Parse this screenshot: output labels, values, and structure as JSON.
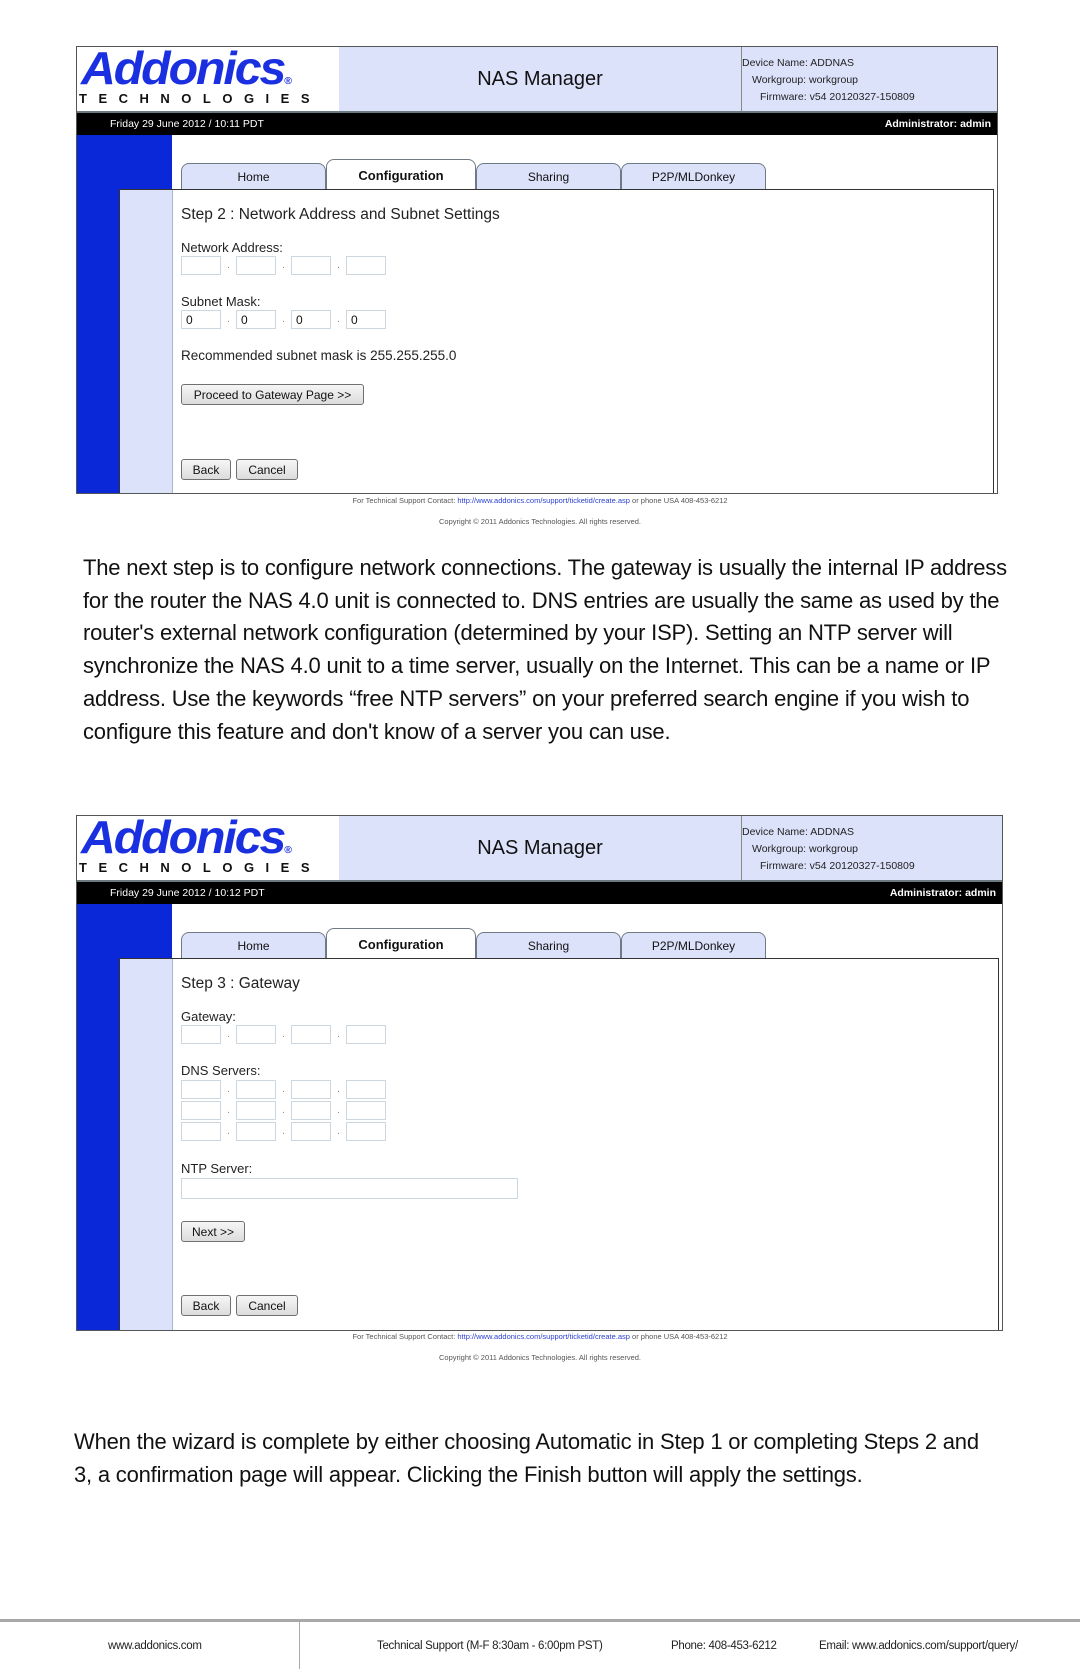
{
  "screenshots": [
    {
      "header": {
        "logo_word": "Addonics",
        "logo_reg": "®",
        "logo_sub": "TECHNOLOGIES",
        "title": "NAS Manager",
        "device_name": "Device Name: ADDNAS",
        "workgroup": "Workgroup: workgroup",
        "firmware": "Firmware: v54 20120327-150809"
      },
      "bar": {
        "date": "Friday 29 June 2012 / 10:11 PDT",
        "admin": "Administrator: admin"
      },
      "tabs": [
        {
          "label": "Home",
          "active": false
        },
        {
          "label": "Configuration",
          "active": true
        },
        {
          "label": "Sharing",
          "active": false
        },
        {
          "label": "P2P/MLDonkey",
          "active": false
        }
      ],
      "step_title": "Step 2 : Network Address and Subnet Settings",
      "network_address": {
        "label": "Network Address:",
        "octets": [
          "",
          "",
          "",
          ""
        ]
      },
      "subnet_mask": {
        "label": "Subnet Mask:",
        "octets": [
          "0",
          "0",
          "0",
          "0"
        ]
      },
      "recommendation": "Recommended subnet mask is 255.255.255.0",
      "proceed_button": "Proceed to Gateway Page >>",
      "back_button": "Back",
      "cancel_button": "Cancel",
      "footer": {
        "support_prefix": "For Technical Support Contact: ",
        "support_link": "http://www.addonics.com/support/ticketid/create.asp",
        "support_suffix": " or phone USA 408-453-6212",
        "copyright": "Copyright © 2011 Addonics Technologies. All rights reserved."
      }
    },
    {
      "header": {
        "logo_word": "Addonics",
        "logo_reg": "®",
        "logo_sub": "TECHNOLOGIES",
        "title": "NAS Manager",
        "device_name": "Device Name: ADDNAS",
        "workgroup": "Workgroup: workgroup",
        "firmware": "Firmware: v54 20120327-150809"
      },
      "bar": {
        "date": "Friday 29 June 2012 / 10:12 PDT",
        "admin": "Administrator: admin"
      },
      "tabs": [
        {
          "label": "Home",
          "active": false
        },
        {
          "label": "Configuration",
          "active": true
        },
        {
          "label": "Sharing",
          "active": false
        },
        {
          "label": "P2P/MLDonkey",
          "active": false
        }
      ],
      "step_title": "Step 3 : Gateway",
      "gateway": {
        "label": "Gateway:",
        "octets": [
          "",
          "",
          "",
          ""
        ]
      },
      "dns": {
        "label": "DNS Servers:",
        "rows": [
          [
            "",
            "",
            "",
            ""
          ],
          [
            "",
            "",
            "",
            ""
          ],
          [
            "",
            "",
            "",
            ""
          ]
        ]
      },
      "ntp": {
        "label": "NTP Server:",
        "value": ""
      },
      "next_button": "Next >>",
      "back_button": "Back",
      "cancel_button": "Cancel",
      "footer": {
        "support_prefix": "For Technical Support Contact: ",
        "support_link": "http://www.addonics.com/support/ticketid/create.asp",
        "support_suffix": " or phone USA 408-453-6212",
        "copyright": "Copyright © 2011 Addonics Technologies. All rights reserved."
      }
    }
  ],
  "paragraphs": [
    "The next step is to configure network connections. The gateway is usually the internal IP address for the router the NAS 4.0 unit is connected to. DNS entries are usually the same as used by the router's external network configuration (determined by your ISP). Setting an NTP server will synchronize the NAS 4.0 unit to a time server, usually on the Internet. This can be a name or IP address. Use the keywords “free NTP servers” on your preferred search engine if you wish to configure this feature and don't know of a server you can use.",
    "When the wizard is complete by either choosing Automatic in Step 1 or completing Steps 2 and 3, a confirmation page will appear. Clicking the Finish button will apply the settings."
  ],
  "page_footer": {
    "website": "www.addonics.com",
    "support_hours": "Technical Support (M-F 8:30am - 6:00pm PST)",
    "phone": "Phone: 408-453-6212",
    "email": "Email: www.addonics.com/support/query/"
  }
}
